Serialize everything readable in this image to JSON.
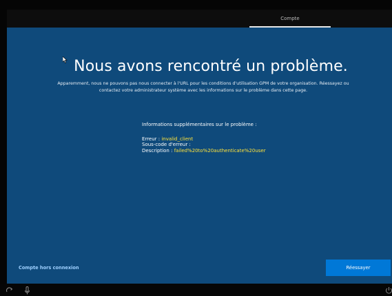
{
  "top_bar": {
    "tab_label": "Compte"
  },
  "main": {
    "title": "Nous avons rencontré un problème.",
    "subtitle_line1": "Apparemment, nous ne pouvons pas nous connecter à l'URL pour les conditions d'utilisation GPM de votre organisation. Réessayez ou",
    "subtitle_line2": "contactez votre administrateur système avec les informations sur le problème dans cette page.",
    "info_heading": "Informations supplémentaires sur le problème :",
    "error_label": "Erreur : ",
    "error_value": "invalid_client",
    "subcode_label": "Sous-code d'erreur :",
    "description_label": "Description : ",
    "description_value": "failed%20to%20authenticate%20user"
  },
  "footer": {
    "offline_label": "Compte hors connexion",
    "retry_label": "Réessayer"
  },
  "colors": {
    "panel_background": "#0f4a7b",
    "accent_button": "#0078d7",
    "error_highlight": "#ffe33b",
    "link": "#9ed0ff"
  },
  "icons": {
    "pointer": "mouse-pointer-icon",
    "ease_of_access": "ease-of-access-icon",
    "microphone": "microphone-icon",
    "power": "power-icon"
  }
}
